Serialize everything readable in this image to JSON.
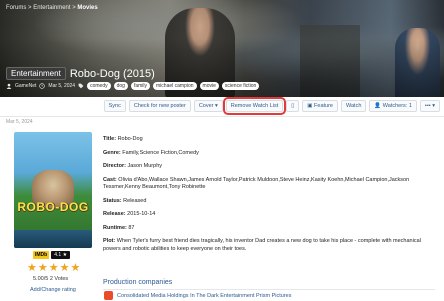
{
  "breadcrumb": [
    "Forums",
    "Entertainment",
    "Movies"
  ],
  "header": {
    "category": "Entertainment",
    "title": "Robo-Dog (2015)",
    "author": "GameNet",
    "date": "Mar 5, 2024",
    "tags": [
      "comedy",
      "dog",
      "family",
      "michael campion",
      "movie",
      "science fiction"
    ]
  },
  "toolbar": {
    "sync": "Sync",
    "check_poster": "Check for new poster",
    "cover": "Cover",
    "remove_watch": "Remove Watch List",
    "feature": "Feature",
    "watch": "Watch",
    "watchers": "Watchers: 1",
    "more": "•••"
  },
  "post": {
    "date": "Mar 5, 2024",
    "poster_title": "ROBO-DOG"
  },
  "rating": {
    "imdb_label": "IMDb",
    "imdb_value": "4.1",
    "votes": "5.00/5 2 Votes",
    "stars": 5,
    "add_rating": "Add/Change rating"
  },
  "details": [
    {
      "label": "Title:",
      "value": "Robo-Dog"
    },
    {
      "label": "Genre:",
      "value": "Family,Science Fiction,Comedy"
    },
    {
      "label": "Director:",
      "value": "Jason Murphy"
    },
    {
      "label": "Cast:",
      "value": "Olivia d'Abo,Wallace Shawn,James Arnold Taylor,Patrick Muldoon,Steve Heinz,Kasity Koehn,Michael Campion,Jackson Tessmer,Kenny Beaumont,Tony Robinette"
    },
    {
      "label": "Status:",
      "value": "Released"
    },
    {
      "label": "Release:",
      "value": "2015-10-14"
    },
    {
      "label": "Runtime:",
      "value": "87"
    },
    {
      "label": "Plot:",
      "value": "When Tyler's furry best friend dies tragically, his inventor Dad creates a new dog to take his place - complete with mechanical powers and robotic abilities to keep everyone on their toes."
    }
  ],
  "production": {
    "heading": "Production companies",
    "company": "Consolidated Media Holdings In The Dark Entertainment Prism Pictures"
  },
  "colors": {
    "accent": "#2c5a8f",
    "highlight": "#e03a3a",
    "star": "#f0a21b",
    "imdb": "#f5c518"
  }
}
